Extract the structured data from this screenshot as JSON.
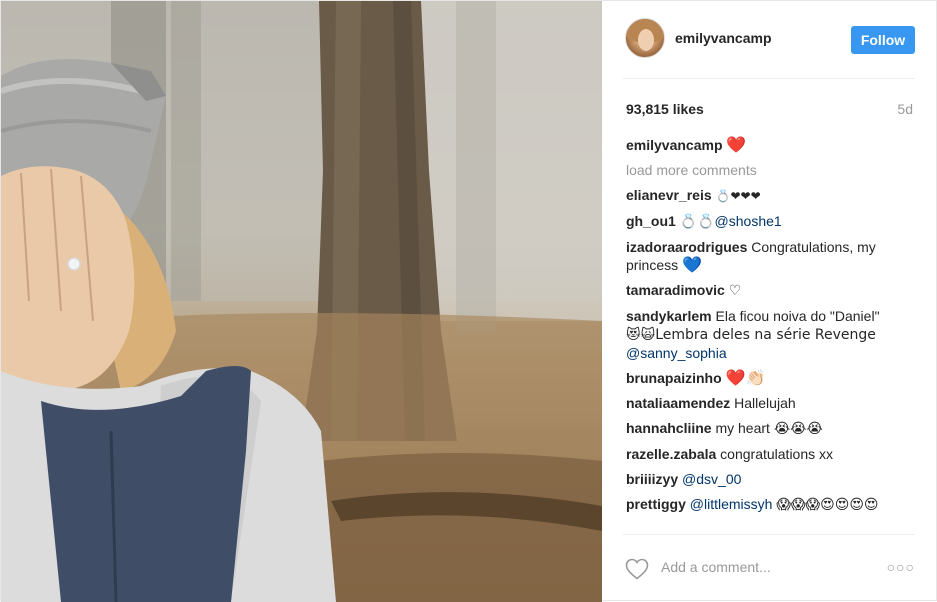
{
  "header": {
    "username": "emilyvancamp",
    "follow_label": "Follow"
  },
  "stats": {
    "likes": "93,815 likes",
    "age": "5d"
  },
  "caption": {
    "user": "emilyvancamp",
    "text": "❤️"
  },
  "load_more": "load more comments",
  "comments": [
    {
      "user": "elianevr_reis",
      "text": "💍❤❤❤"
    },
    {
      "user": "gh_ou1",
      "text": "💍💍",
      "mention": "@shoshe1"
    },
    {
      "user": "izadoraarodrigues",
      "text": "Congratulations, my princess",
      "emoji": "💙"
    },
    {
      "user": "tamaradimovic",
      "text": "♡"
    },
    {
      "user": "sandykarlem",
      "text": "Ela ficou noiva do \"Daniel\"",
      "text2": "😻🙀Lembra deles na série Revenge",
      "mention": "@sanny_sophia"
    },
    {
      "user": "brunapaizinho",
      "text": "❤️👏🏻"
    },
    {
      "user": "nataliaamendez",
      "text": "Hallelujah"
    },
    {
      "user": "hannahcliine",
      "text": "my heart",
      "emoji": "😭😭😭"
    },
    {
      "user": "razelle.zabala",
      "text": "congratulations xx"
    },
    {
      "user": "briiiizyy",
      "mention": "@dsv_00"
    },
    {
      "user": "prettiggy",
      "mention": "@littlemissyh",
      "emoji": "😱😱😱😍😍😍😍"
    }
  ],
  "footer": {
    "add_comment_placeholder": "Add a comment...",
    "more_label": "○○○"
  },
  "colors": {
    "follow_blue": "#3897f0",
    "mention_blue": "#003569",
    "muted_gray": "#999999",
    "heart_red": "#ed4956"
  }
}
